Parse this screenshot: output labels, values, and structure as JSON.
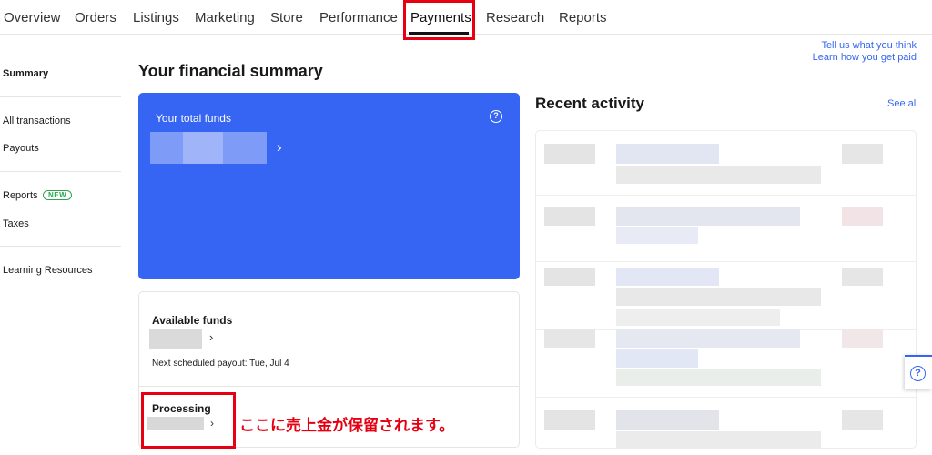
{
  "nav": {
    "tabs": [
      "Overview",
      "Orders",
      "Listings",
      "Marketing",
      "Store",
      "Performance",
      "Payments",
      "Research",
      "Reports"
    ],
    "active": "Payments"
  },
  "feedback": {
    "tell_us": "Tell us what you think",
    "learn_paid": "Learn how you get paid"
  },
  "sidebar": {
    "summary": "Summary",
    "all_transactions": "All transactions",
    "payouts": "Payouts",
    "reports": "Reports",
    "new_badge": "NEW",
    "taxes": "Taxes",
    "learning": "Learning Resources"
  },
  "main": {
    "title": "Your financial summary",
    "total_funds_label": "Your total funds",
    "available_funds_label": "Available funds",
    "next_payout": "Next scheduled payout: Tue, Jul 4",
    "processing_label": "Processing",
    "annotation": "ここに売上金が保留されます。"
  },
  "recent": {
    "title": "Recent activity",
    "see_all": "See all"
  },
  "icons": {
    "help": "question-circle-icon",
    "chevron": "chevron-right-icon"
  },
  "colors": {
    "accent": "#3665f3",
    "highlight": "#e60012"
  }
}
